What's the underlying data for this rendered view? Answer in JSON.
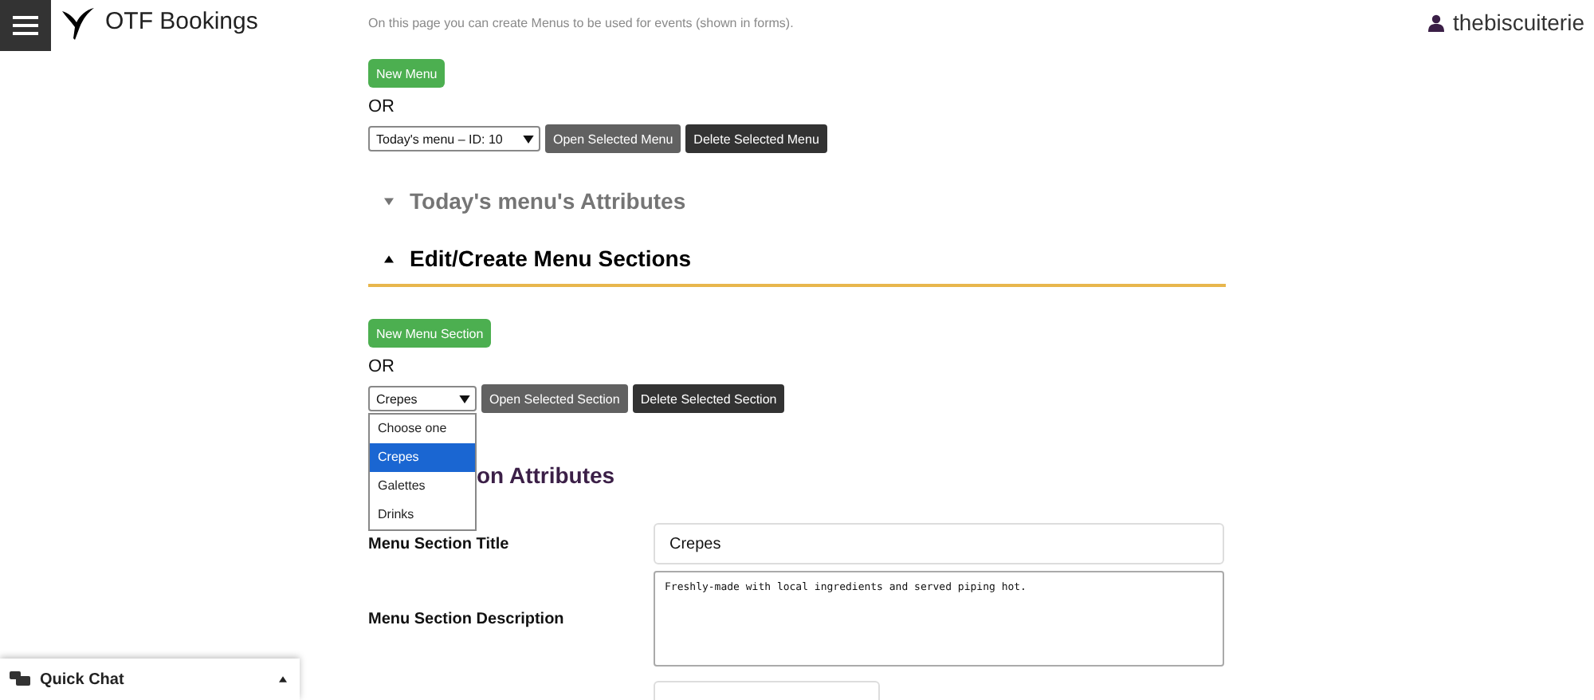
{
  "header": {
    "title": "OTF Bookings",
    "user": "thebiscuiterie"
  },
  "intro": "On this page you can create Menus to be used for events (shown in forms).",
  "menu_picker": {
    "new_button": "New Menu",
    "or": "OR",
    "selected": "Today's menu – ID: 10",
    "open_button": "Open Selected Menu",
    "delete_button": "Delete Selected Menu"
  },
  "sections": [
    {
      "title": "Today's menu's Attributes",
      "expanded": false
    },
    {
      "title": "Edit/Create Menu Sections",
      "expanded": true
    }
  ],
  "section_picker": {
    "new_button": "New Menu Section",
    "or": "OR",
    "selected": "Crepes",
    "open_button": "Open Selected Section",
    "delete_button": "Delete Selected Section",
    "expanded": true,
    "options": [
      {
        "label": "Choose one",
        "selected": false
      },
      {
        "label": "Crepes",
        "selected": true
      },
      {
        "label": "Galettes",
        "selected": false
      },
      {
        "label": "Drinks",
        "selected": false
      }
    ]
  },
  "attributes_heading": "on Attributes",
  "form": [
    {
      "label": "Menu Section Title",
      "kind": "text",
      "value": "Crepes"
    },
    {
      "label": "Menu Section Description",
      "kind": "textarea",
      "value": "Freshly-made with local ingredients and served piping hot."
    }
  ],
  "quick_chat": {
    "label": "Quick Chat",
    "expanded": false
  }
}
